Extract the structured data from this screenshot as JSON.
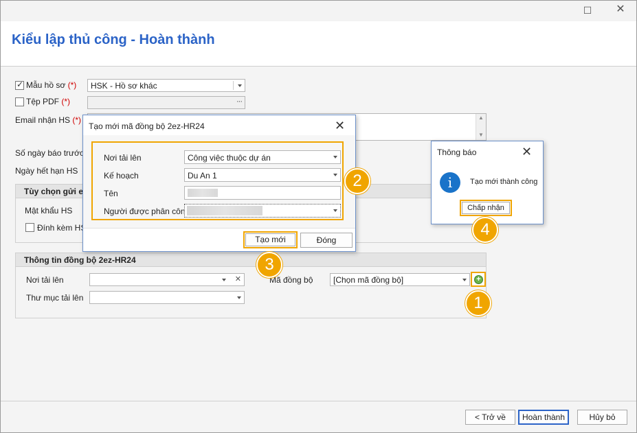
{
  "window": {
    "title": "Kiểu lập thủ công - Hoàn thành"
  },
  "form": {
    "mau_ho_so": {
      "label": "Mẫu hồ sơ",
      "required": "(*)",
      "value": "HSK - Hồ sơ khác",
      "checked": true
    },
    "tep_pdf": {
      "label": "Tệp PDF",
      "required": "(*)",
      "value": ""
    },
    "email_nhan": {
      "label": "Email nhận HS",
      "required": "(*)"
    },
    "so_ngay_bao_truoc": {
      "label": "Số ngày báo trước"
    },
    "ngay_het_han": {
      "label": "Ngày hết hạn HS"
    }
  },
  "group_options": {
    "header": "Tùy chọn gửi e",
    "mat_khau_label": "Mật khẩu HS",
    "dinh_kem_label": "Đính kèm HS k"
  },
  "group_sync": {
    "header": "Thông tin đồng bộ 2ez-HR24",
    "noi_tai_len_label": "Nơi tải lên",
    "thu_muc_label": "Thư mục tải lên",
    "ma_dong_bo_label": "Mã đồng bộ",
    "ma_dong_bo_value": "[Chọn mã đồng bộ]"
  },
  "dialog_create": {
    "title": "Tạo mới mã đồng bộ 2ez-HR24",
    "fields": {
      "noi_tai_len": {
        "label": "Nơi tải lên",
        "value": "Công việc thuộc dự án"
      },
      "ke_hoach": {
        "label": "Kế hoạch",
        "value": "Du An 1"
      },
      "ten": {
        "label": "Tên"
      },
      "nguoi_phan_cong": {
        "label": "Người được phân công"
      }
    },
    "create_button": "Tạo mới",
    "close_button": "Đóng"
  },
  "dialog_notice": {
    "title": "Thông báo",
    "icon_glyph": "i",
    "message": "Tạo mới thành công",
    "accept_button": "Chấp nhận"
  },
  "steps": [
    "1",
    "2",
    "3",
    "4"
  ],
  "footer": {
    "back_button": "< Trở về",
    "finish_button": "Hoàn thành",
    "cancel_button": "Hủy bỏ"
  },
  "colors": {
    "title_blue": "#2b63c7",
    "highlight_orange": "#f0a500",
    "required_red": "#d00000",
    "info_blue": "#1a73c9"
  }
}
